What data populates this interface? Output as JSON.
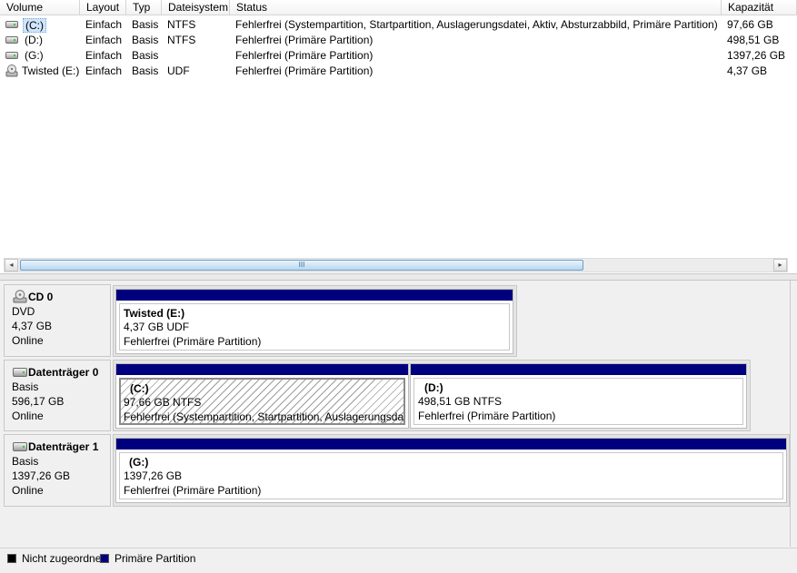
{
  "columns": [
    "Volume",
    "Layout",
    "Typ",
    "Dateisystem",
    "Status",
    "Kapazität"
  ],
  "volumes": [
    {
      "icon": "drive-icon",
      "volume": "(C:)",
      "layout": "Einfach",
      "typ": "Basis",
      "fs": "NTFS",
      "status": "Fehlerfrei (Systempartition, Startpartition, Auslagerungsdatei, Aktiv, Absturzabbild, Primäre Partition)",
      "capacity": "97,66 GB"
    },
    {
      "icon": "drive-icon",
      "volume": "(D:)",
      "layout": "Einfach",
      "typ": "Basis",
      "fs": "NTFS",
      "status": "Fehlerfrei (Primäre Partition)",
      "capacity": "498,51 GB"
    },
    {
      "icon": "drive-icon",
      "volume": "(G:)",
      "layout": "Einfach",
      "typ": "Basis",
      "fs": "",
      "status": "Fehlerfrei (Primäre Partition)",
      "capacity": "1397,26 GB"
    },
    {
      "icon": "cd-drive-icon",
      "volume": "Twisted (E:)",
      "layout": "Einfach",
      "typ": "Basis",
      "fs": "UDF",
      "status": "Fehlerfrei (Primäre Partition)",
      "capacity": "4,37 GB"
    }
  ],
  "scrollbar": {
    "thumb_grip": "III",
    "left_arrow": "◂",
    "right_arrow": "▸"
  },
  "disks": [
    {
      "icon": "cd-drive-icon",
      "name": "CD 0",
      "kind": "DVD",
      "size": "4,37 GB",
      "state": "Online",
      "partitions": [
        {
          "title": "Twisted  (E:)",
          "size": "4,37 GB UDF",
          "status": "Fehlerfrei (Primäre Partition)",
          "hatched": false
        }
      ]
    },
    {
      "icon": "disk-icon",
      "name": "Datenträger 0",
      "kind": "Basis",
      "size": "596,17 GB",
      "state": "Online",
      "partitions": [
        {
          "title": "(C:)",
          "size": "97,66 GB NTFS",
          "status": "Fehlerfrei (Systempartition, Startpartition, Auslagerungsdatei",
          "hatched": true
        },
        {
          "title": "(D:)",
          "size": "498,51 GB NTFS",
          "status": "Fehlerfrei (Primäre Partition)",
          "hatched": false
        }
      ]
    },
    {
      "icon": "disk-icon",
      "name": "Datenträger 1",
      "kind": "Basis",
      "size": "1397,26 GB",
      "state": "Online",
      "partitions": [
        {
          "title": "(G:)",
          "size": "1397,26 GB",
          "status": "Fehlerfrei (Primäre Partition)",
          "hatched": false
        }
      ]
    }
  ],
  "legend": [
    {
      "label": "Nicht zugeordnet",
      "color": "#000000"
    },
    {
      "label": "Primäre Partition",
      "color": "#00007f"
    }
  ],
  "colors": {
    "partition_bar": "#00007f",
    "selection": "#cfe5fb"
  }
}
